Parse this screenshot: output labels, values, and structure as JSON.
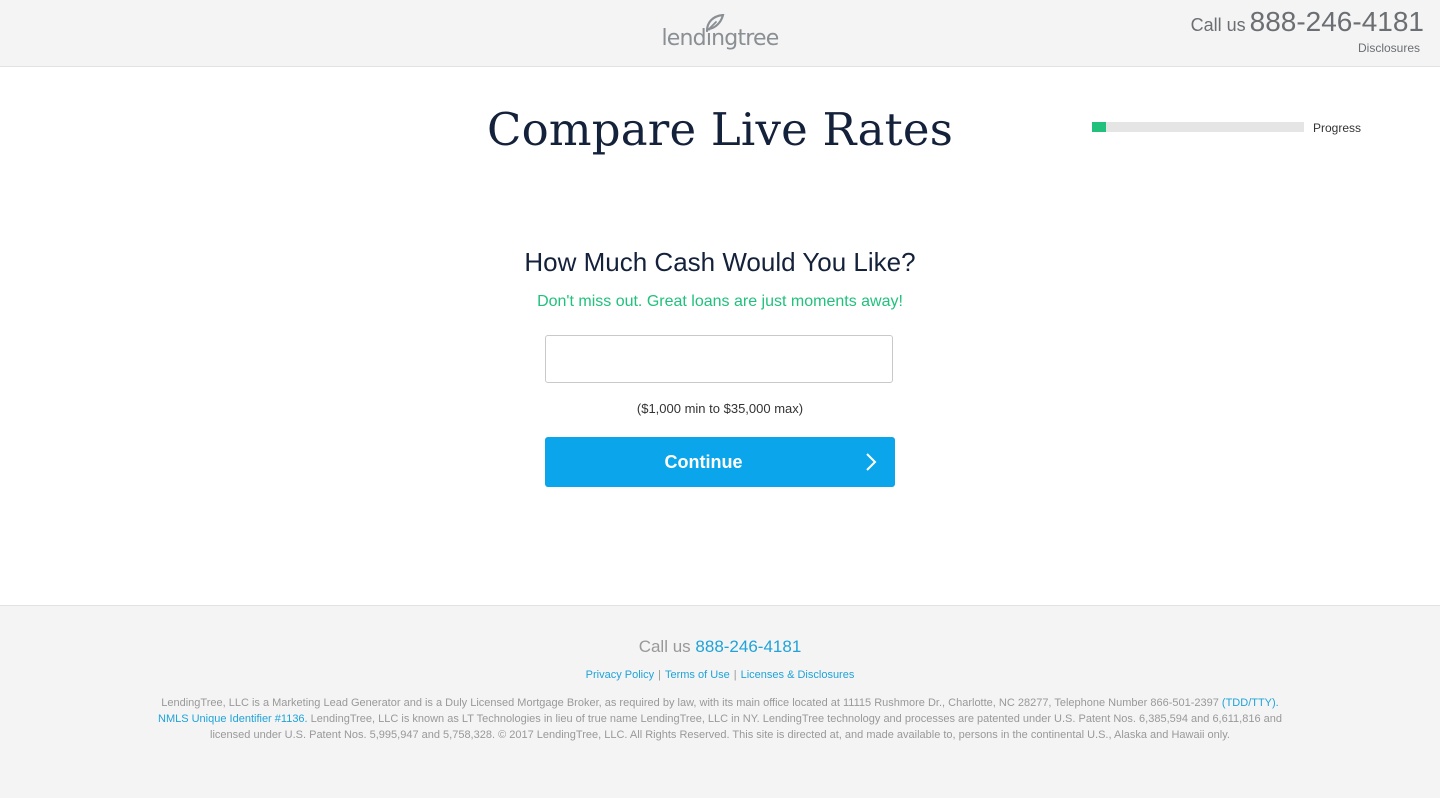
{
  "header": {
    "logo_text": "lendingtree",
    "call_label": "Call us",
    "phone": "888-246-4181",
    "disclosures_label": "Disclosures"
  },
  "main": {
    "title": "Compare Live Rates",
    "progress": {
      "label": "Progress",
      "value": 0.065,
      "fill_color": "#21c17c"
    },
    "question": "How Much Cash Would You Like?",
    "promo": "Don't miss out. Great loans are just moments away!",
    "amount_input": {
      "value": "",
      "placeholder": ""
    },
    "hint": "($1,000 min to $35,000 max)",
    "continue_label": "Continue",
    "accent_color": "#0aa5ea"
  },
  "footer": {
    "call_label": "Call us",
    "phone": "888-246-4181",
    "links": [
      "Privacy Policy",
      "Terms of Use",
      "Licenses & Disclosures"
    ],
    "legal_1": "LendingTree, LLC is a Marketing Lead Generator and is a Duly Licensed Mortgage Broker, as required by law, with its main office located at 11115 Rushmore Dr., Charlotte, NC 28277, Telephone Number 866-501-2397",
    "legal_link": "(TDD/TTY). NMLS Unique Identifier #1136.",
    "legal_2": "LendingTree, LLC is known as LT Technologies in lieu of true name LendingTree, LLC in NY. LendingTree technology and processes are patented under U.S. Patent Nos. 6,385,594 and 6,611,816 and licensed under U.S. Patent Nos. 5,995,947 and 5,758,328. © 2017 LendingTree, LLC. All Rights Reserved. This site is directed at, and made available to, persons in the continental U.S., Alaska and Hawaii only."
  }
}
